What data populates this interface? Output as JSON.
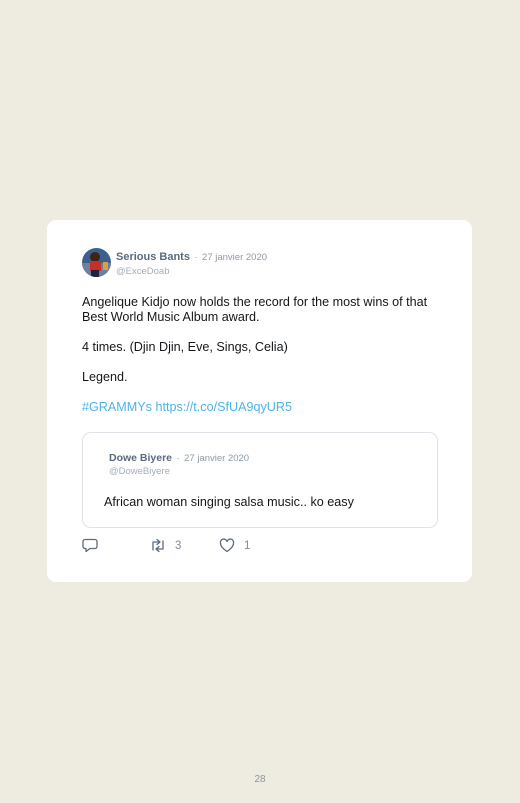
{
  "tweet": {
    "author": "Serious Bants",
    "separator": "·",
    "date": "27 janvier 2020",
    "handle": "@ExceDoab",
    "line1": "Angelique Kidjo now holds the record for the most wins of that Best World Music Album award.",
    "line2": "4 times. (Djin Djin, Eve, Sings, Celia)",
    "line3": "Legend.",
    "hashtag": "#GRAMMYs",
    "url": "https://t.co/SfUA9qyUR5"
  },
  "quoted": {
    "author": "Dowe Biyere",
    "separator": "·",
    "date": "27 janvier 2020",
    "handle": "@DoweBiyere",
    "text": "African woman singing salsa music.. ko easy"
  },
  "actions": {
    "reply_icon": "reply-icon",
    "retweet_icon": "retweet-icon",
    "retweet_count": "3",
    "like_icon": "heart-icon",
    "like_count": "1"
  },
  "page_number": "28",
  "colors": {
    "background": "#eeebe1",
    "card": "#ffffff",
    "link": "#4fb3e6",
    "author": "#5a6b7e"
  }
}
